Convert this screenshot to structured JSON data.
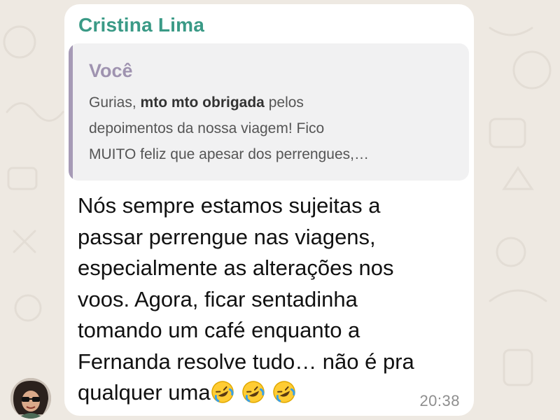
{
  "message": {
    "sender_name": "Cristina Lima",
    "quoted": {
      "author": "Você",
      "line1_part1": "Gurias, ",
      "line1_bold": "mto mto obrigada",
      "line1_part2": " pelos",
      "line2": "depoimentos da nossa viagem! Fico",
      "line3": "MUITO feliz que apesar dos perrengues,…"
    },
    "body_lines": [
      "Nós sempre estamos sujeitas a",
      "passar perrengue nas viagens,",
      "especialmente as alterações nos",
      "voos. Agora, ficar sentadinha",
      "tomando um café enquanto a",
      "Fernanda resolve tudo… não é pra",
      "qualquer uma"
    ],
    "emojis": [
      "rolling-on-floor-laughing",
      "rolling-on-floor-laughing",
      "rolling-on-floor-laughing"
    ],
    "time": "20:38"
  },
  "colors": {
    "sender": "#3a9a86",
    "quote_bar": "#a69ab6",
    "background": "#eee9e2",
    "bubble": "#ffffff"
  }
}
